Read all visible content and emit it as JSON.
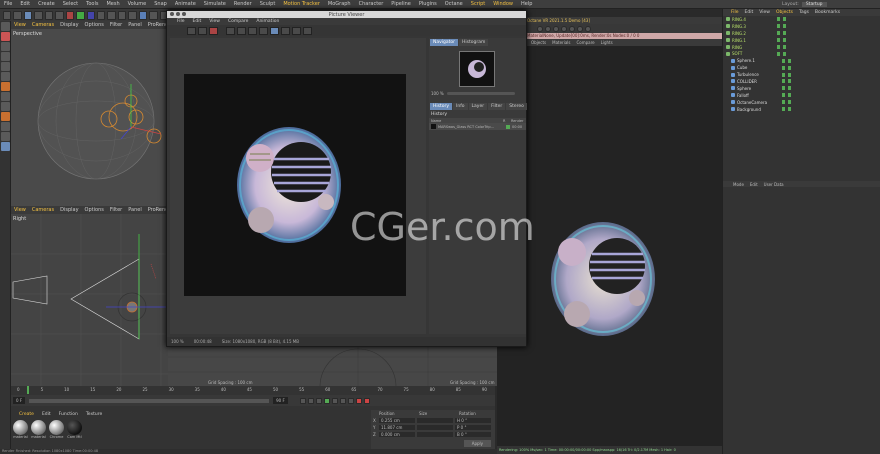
{
  "menubar": {
    "items": [
      "File",
      "Edit",
      "Create",
      "Select",
      "Tools",
      "Mesh",
      "Volume",
      "Snap",
      "Animate",
      "Simulate",
      "Render",
      "Sculpt",
      "Motion Tracker",
      "MoGraph",
      "Character",
      "Pipeline",
      "Plugins",
      "Octane",
      "Script",
      "Window",
      "Help"
    ],
    "highlighted": [
      "Motion Tracker",
      "Script",
      "Window"
    ],
    "layout_label": "Layout:",
    "layout_value": "Startup"
  },
  "viewport_top": {
    "menu": [
      "View",
      "Cameras",
      "Display",
      "Options",
      "Filter",
      "Panel",
      "ProRender"
    ],
    "label": "Perspective"
  },
  "viewport_bottom": {
    "menu": [
      "View",
      "Cameras",
      "Display",
      "Options",
      "Filter",
      "Panel",
      "ProRender"
    ],
    "label": "Right",
    "grid_spacing_left": "Grid Spacing : 100 cm",
    "grid_spacing_right": "Grid Spacing : 100 cm"
  },
  "picture_viewer": {
    "title": "Picture Viewer",
    "menu": [
      "File",
      "Edit",
      "View",
      "Compare",
      "Animation"
    ],
    "side_tabs": [
      "Navigator",
      "Histogram"
    ],
    "zoom": "100 %",
    "sub_tabs": [
      "History",
      "Info",
      "Layer",
      "Filter",
      "Stereo"
    ],
    "history_header": "History",
    "history_cols": [
      "Name",
      "R",
      "Render"
    ],
    "history_row_name": "MARSwas_Glass RCT ColorTrip…",
    "history_row_value": "00:00",
    "status_zoom": "100 %",
    "status_time": "00:00:48",
    "status_size": "Size: 1080x1080, RGB (8 Bit), 4.15 MB"
  },
  "watermark": "CGer.com",
  "render_window": {
    "header": "Octane VR 2021.1.5 Demo [43]",
    "info": "MaterialNone, Update[00]:0ms, Render:0s Nodes:0 / 0 0",
    "tabs": [
      "Objects",
      "Materials",
      "Compare",
      "Lights"
    ],
    "status_bar": "Rendering: 100%  Ms/sec: 1  Time: 00:00:00/00:00:00  Spp/maxspp: 16/16  Tri: 0/2.17M  Mesh: 1  Hair: 0"
  },
  "object_manager": {
    "menu": [
      "File",
      "Edit",
      "View",
      "Objects",
      "Tags",
      "Bookmarks"
    ],
    "objects": [
      {
        "name": "RING.4",
        "green": true
      },
      {
        "name": "RING.3",
        "green": true
      },
      {
        "name": "RING.2",
        "green": true
      },
      {
        "name": "RING.1",
        "green": true
      },
      {
        "name": "RING",
        "green": true
      },
      {
        "name": "SOFT",
        "green": true
      },
      {
        "name": "Sphere.1",
        "green": false
      },
      {
        "name": "Cube",
        "green": false
      },
      {
        "name": "Turbulence",
        "green": false
      },
      {
        "name": "COLLIDER",
        "green": false
      },
      {
        "name": "Sphere",
        "green": false
      },
      {
        "name": "Falloff",
        "green": false
      },
      {
        "name": "OctaneCamera",
        "green": false
      },
      {
        "name": "Background",
        "green": false
      }
    ]
  },
  "attributes": {
    "menu": [
      "Mode",
      "Edit",
      "User Data"
    ]
  },
  "timeline": {
    "start_frame": "0 F",
    "end_frame": "90 F",
    "ticks": [
      "0",
      "5",
      "10",
      "15",
      "20",
      "25",
      "30",
      "35",
      "40",
      "45",
      "50",
      "55",
      "60",
      "65",
      "70",
      "75",
      "80",
      "85",
      "90"
    ]
  },
  "material_manager": {
    "menu": [
      "Create",
      "Edit",
      "Function",
      "Texture"
    ],
    "materials": [
      "material",
      "material",
      "Chrome",
      "Cam Mtl"
    ]
  },
  "coordinates": {
    "headers": [
      "Position",
      "Size",
      "Rotation"
    ],
    "rows": [
      {
        "axis": "X",
        "pos": "0.255 cm",
        "rot": "H 0 °"
      },
      {
        "axis": "Y",
        "pos": "11.807 cm",
        "rot": "P 0 °"
      },
      {
        "axis": "Z",
        "pos": "0.000 cm",
        "rot": "B 0 °"
      }
    ],
    "apply_label": "Apply"
  },
  "status_bar": "Render Finished: Resolution 1080x1080 Time:00:00:48"
}
